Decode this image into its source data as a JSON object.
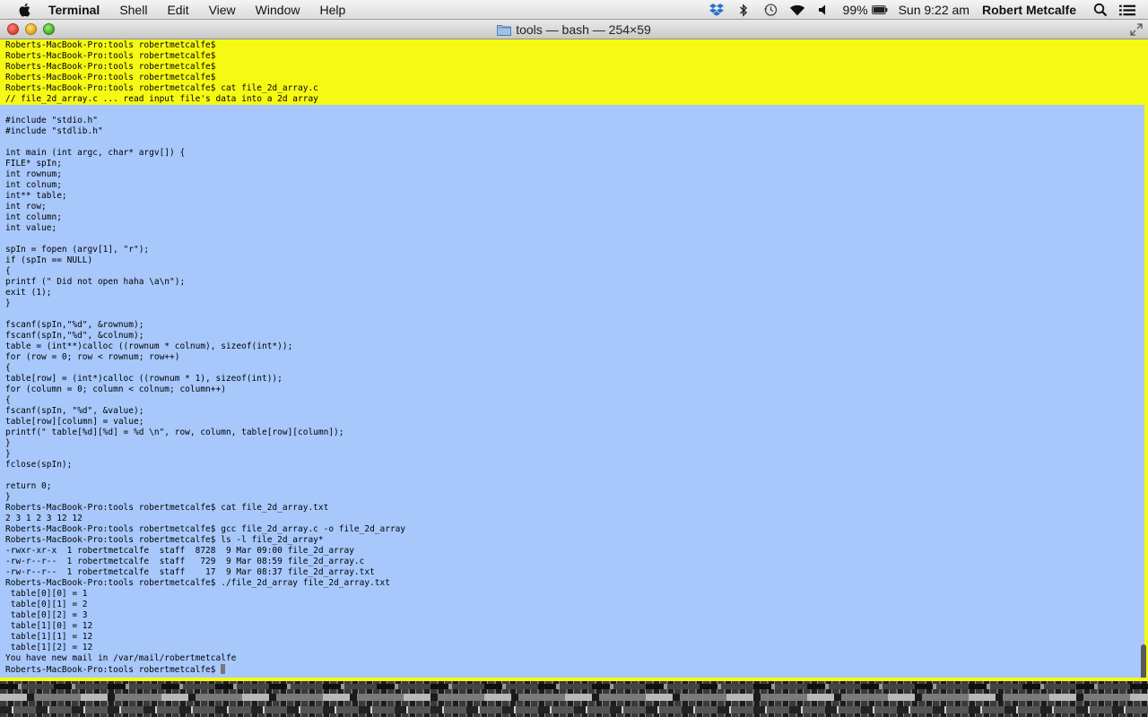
{
  "menubar": {
    "app_name": "Terminal",
    "items": [
      "Shell",
      "Edit",
      "View",
      "Window",
      "Help"
    ],
    "battery": "99%",
    "clock": "Sun 9:22 am",
    "user": "Robert Metcalfe",
    "icons": [
      "apple-icon",
      "dropbox-icon",
      "bluetooth-icon",
      "time-machine-icon",
      "wifi-icon",
      "volume-icon",
      "battery-icon",
      "spotlight-icon",
      "notification-list-icon"
    ]
  },
  "window": {
    "title": "tools — bash — 254×59"
  },
  "terminal": {
    "background": "#f6f914",
    "selection_color": "#a8c8fc",
    "lines": [
      "Roberts-MacBook-Pro:tools robertmetcalfe$",
      "Roberts-MacBook-Pro:tools robertmetcalfe$",
      "Roberts-MacBook-Pro:tools robertmetcalfe$",
      "Roberts-MacBook-Pro:tools robertmetcalfe$",
      "Roberts-MacBook-Pro:tools robertmetcalfe$ cat file_2d_array.c",
      "// file_2d_array.c ... read input file's data into a 2d array",
      "",
      "#include \"stdio.h\"",
      "#include \"stdlib.h\"",
      "",
      "int main (int argc, char* argv[]) {",
      "FILE* spIn;",
      "int rownum;",
      "int colnum;",
      "int** table;",
      "int row;",
      "int column;",
      "int value;",
      "",
      "spIn = fopen (argv[1], \"r\");",
      "if (spIn == NULL)",
      "{",
      "printf (\" Did not open haha \\a\\n\");",
      "exit (1);",
      "}",
      "",
      "fscanf(spIn,\"%d\", &rownum);",
      "fscanf(spIn,\"%d\", &colnum);",
      "table = (int**)calloc ((rownum * colnum), sizeof(int*));",
      "for (row = 0; row < rownum; row++)",
      "{",
      "table[row] = (int*)calloc ((rownum * 1), sizeof(int));",
      "for (column = 0; column < colnum; column++)",
      "{",
      "fscanf(spIn, \"%d\", &value);",
      "table[row][column] = value;",
      "printf(\" table[%d][%d] = %d \\n\", row, column, table[row][column]);",
      "}",
      "}",
      "fclose(spIn);",
      "",
      "return 0;",
      "}",
      "Roberts-MacBook-Pro:tools robertmetcalfe$ cat file_2d_array.txt",
      "2 3 1 2 3 12 12",
      "Roberts-MacBook-Pro:tools robertmetcalfe$ gcc file_2d_array.c -o file_2d_array",
      "Roberts-MacBook-Pro:tools robertmetcalfe$ ls -l file_2d_array*",
      "-rwxr-xr-x  1 robertmetcalfe  staff  8728  9 Mar 09:00 file_2d_array",
      "-rw-r--r--  1 robertmetcalfe  staff   729  9 Mar 08:59 file_2d_array.c",
      "-rw-r--r--  1 robertmetcalfe  staff    17  9 Mar 08:37 file_2d_array.txt",
      "Roberts-MacBook-Pro:tools robertmetcalfe$ ./file_2d_array file_2d_array.txt",
      " table[0][0] = 1",
      " table[0][1] = 2",
      " table[0][2] = 3",
      " table[1][0] = 12",
      " table[1][1] = 12",
      " table[1][2] = 12",
      "You have new mail in /var/mail/robertmetcalfe",
      "Roberts-MacBook-Pro:tools robertmetcalfe$ "
    ]
  }
}
